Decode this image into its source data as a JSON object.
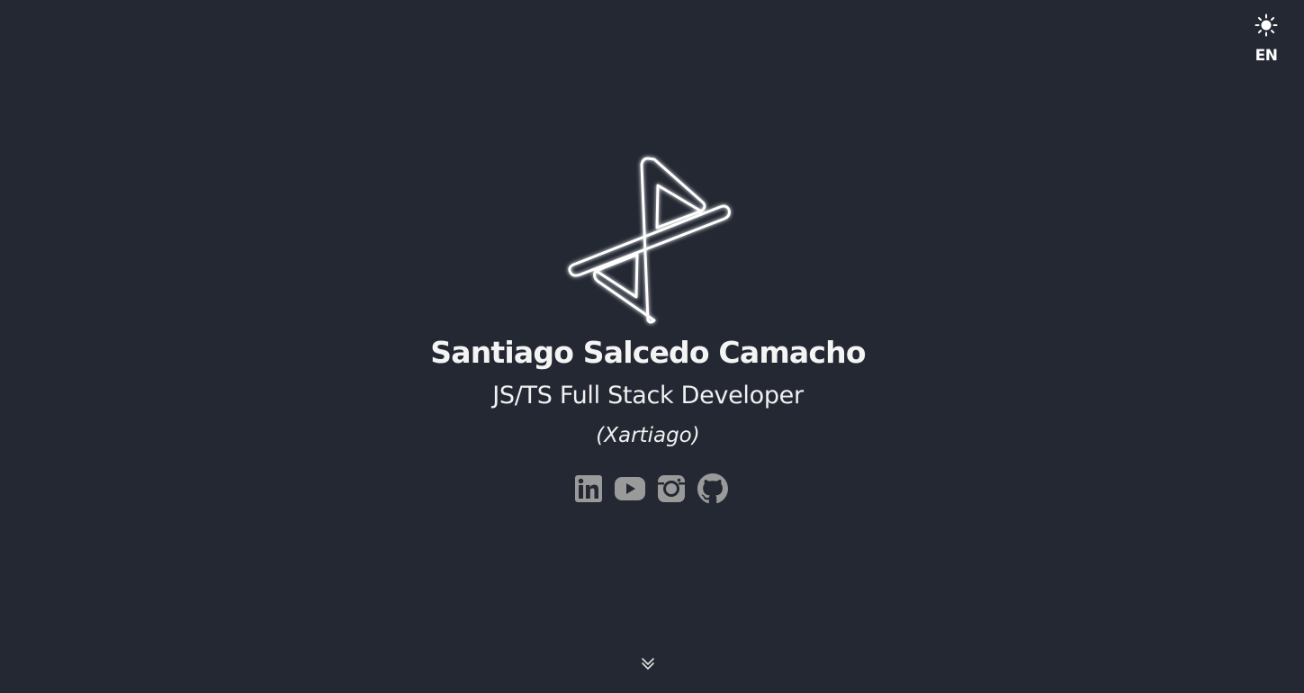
{
  "header": {
    "theme_icon": "sun-icon",
    "language_label": "EN"
  },
  "hero": {
    "logo_icon": "xartiago-logo",
    "name": "Santiago Salcedo Camacho",
    "role": "JS/TS Full Stack Developer",
    "alias": "(Xartiago)"
  },
  "socials": [
    {
      "name": "linkedin-icon"
    },
    {
      "name": "youtube-icon"
    },
    {
      "name": "instagram-icon"
    },
    {
      "name": "github-icon"
    }
  ],
  "scroll": {
    "icon": "double-chevron-down-icon"
  },
  "colors": {
    "background": "#232833",
    "text": "#f2f2f2",
    "social_icon": "#9a9a9a"
  }
}
